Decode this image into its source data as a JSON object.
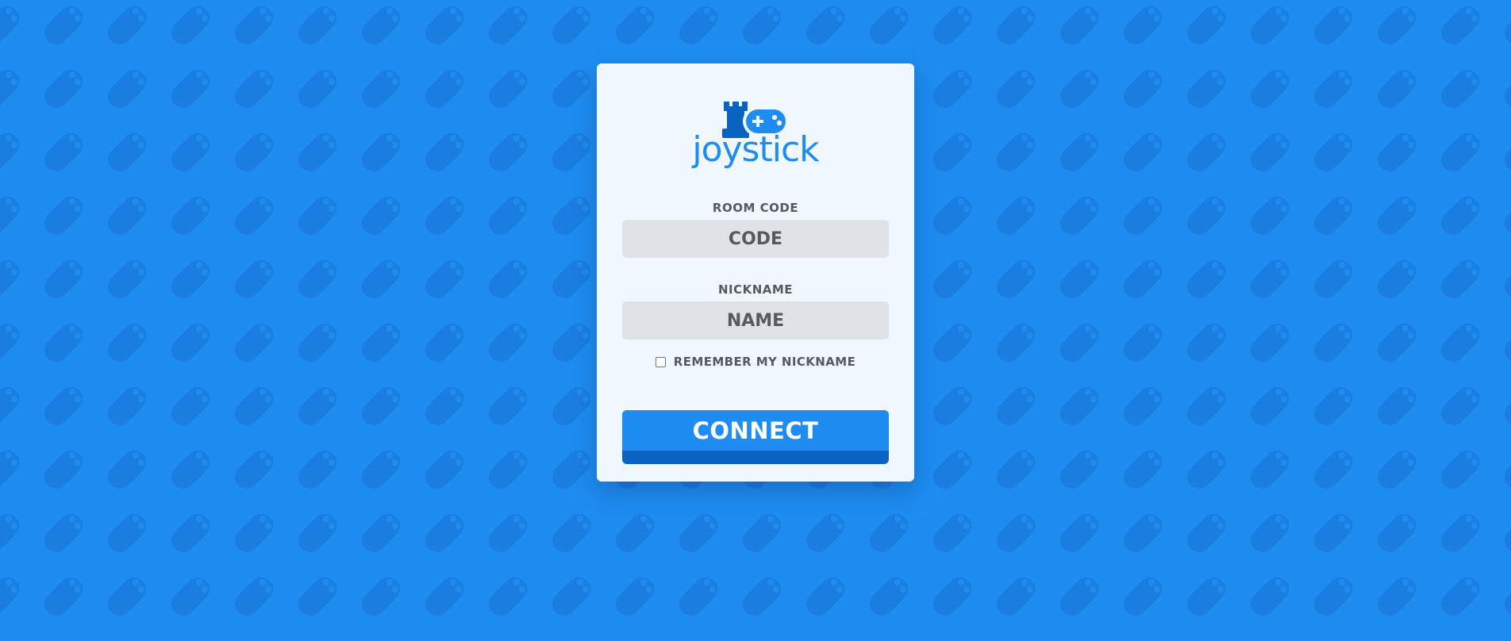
{
  "app": {
    "logo_text": "joystick"
  },
  "form": {
    "room_code": {
      "label": "ROOM CODE",
      "placeholder": "CODE",
      "value": ""
    },
    "nickname": {
      "label": "NICKNAME",
      "placeholder": "NAME",
      "value": ""
    },
    "remember": {
      "label": "REMEMBER MY NICKNAME",
      "checked": false
    },
    "connect_label": "CONNECT"
  },
  "icons": {
    "background_pattern": "gamepad-icon",
    "logo_mark": [
      "rook-icon",
      "gamepad-icon"
    ]
  },
  "colors": {
    "background": "#1e8cf0",
    "pattern": "#1a7ee0",
    "card": "#f0f7fd",
    "accent": "#1e8cf0",
    "accent_dark": "#0a63c0",
    "input_bg": "#dfe3e8",
    "label_text": "#555a60"
  }
}
